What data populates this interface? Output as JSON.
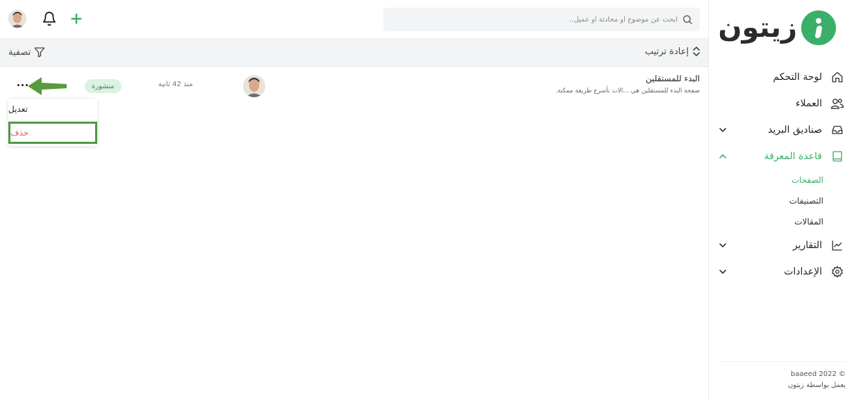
{
  "brand": {
    "name": "زيتون",
    "accent_color": "#3aaf6a"
  },
  "header": {
    "search_placeholder": "ابحث عن موضوع أو محادثة أو عميل..",
    "icons": [
      "search-icon",
      "bell-icon",
      "plus-icon",
      "avatar"
    ]
  },
  "sidebar": {
    "items": [
      {
        "label": "لوحة التحكم",
        "icon": "home-icon",
        "has_chevron": false
      },
      {
        "label": "العملاء",
        "icon": "users-icon",
        "has_chevron": false
      },
      {
        "label": "صناديق البريد",
        "icon": "inbox-icon",
        "has_chevron": true
      },
      {
        "label": "قاعدة المعرفة",
        "icon": "book-icon",
        "has_chevron": true,
        "active": true
      },
      {
        "label": "التقارير",
        "icon": "chart-icon",
        "has_chevron": true
      },
      {
        "label": "الإعدادات",
        "icon": "gear-icon",
        "has_chevron": true
      }
    ],
    "knowledge_sub": [
      {
        "label": "الصفحات",
        "active": true
      },
      {
        "label": "التصنيفات"
      },
      {
        "label": "المقالات"
      }
    ],
    "footer": {
      "copyright": "© 2022 baaeed",
      "powered": "يعمل بواسطة زيتون"
    }
  },
  "toolbar": {
    "reorder_label": "إعادة ترتيب",
    "filter_label": "تصفية"
  },
  "rows": [
    {
      "title": "البدء للمستقلين",
      "description": "صفحة البدء للمستقلين هي ...الات بأسرع طريقة ممكنة.",
      "time": "منذ 42 ثانية",
      "status": "منشورة"
    }
  ],
  "menu": {
    "edit_label": "تعديل",
    "delete_label": "حذف"
  }
}
